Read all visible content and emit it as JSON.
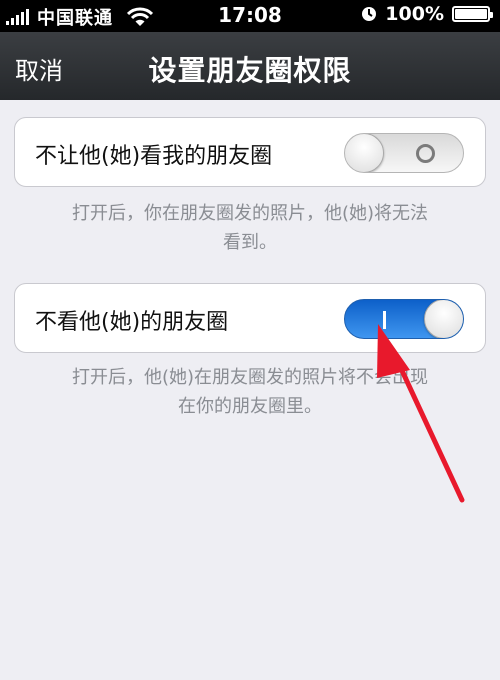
{
  "status_bar": {
    "carrier": "中国联通",
    "time": "17:08",
    "battery": "100%"
  },
  "nav": {
    "cancel_label": "取消",
    "title": "设置朋友圈权限"
  },
  "settings": [
    {
      "label": "不让他(她)看我的朋友圈",
      "enabled": false,
      "description_lines": [
        "打开后，你在朋友圈发的照片，他(她)将无法",
        "看到。"
      ]
    },
    {
      "label": "不看他(她)的朋友圈",
      "enabled": true,
      "description_lines": [
        "打开后，他(她)在朋友圈发的照片将不会出现",
        "在你的朋友圈里。"
      ]
    }
  ],
  "colors": {
    "toggle_on": "#1a73e0",
    "annotation_arrow": "#e8192c",
    "nav_bg": "#2f3236"
  },
  "icons": [
    "signal-icon",
    "wifi-icon",
    "alarm-icon",
    "battery-icon",
    "annotation-arrow-icon"
  ]
}
